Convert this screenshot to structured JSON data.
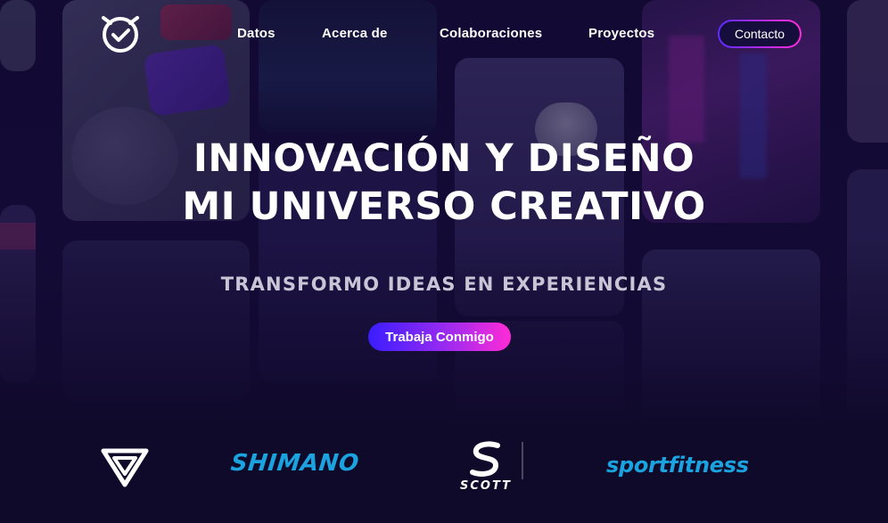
{
  "nav": {
    "logo_icon": "clock-face-logo-icon",
    "links": [
      "Datos",
      "Acerca de",
      "Colaboraciones",
      "Proyectos"
    ],
    "contact_label": "Contacto"
  },
  "hero": {
    "title_line1": "INNOVACIÓN Y DISEÑO",
    "title_line2": "MI UNIVERSO CREATIVO",
    "subtitle": "TRANSFORMO IDEAS EN EXPERIENCIAS",
    "cta_label": "Trabaja Conmigo"
  },
  "partners": {
    "brand1_icon": "angular-shield-logo-icon",
    "shimano": "SHIMANO",
    "scott": "SCOTT",
    "sportfitness": "sportfitness"
  },
  "colors": {
    "accent_start": "#3a1dff",
    "accent_end": "#ff2bd6",
    "brand_blue": "#1ba3e0",
    "background": "#0f0a2e"
  }
}
